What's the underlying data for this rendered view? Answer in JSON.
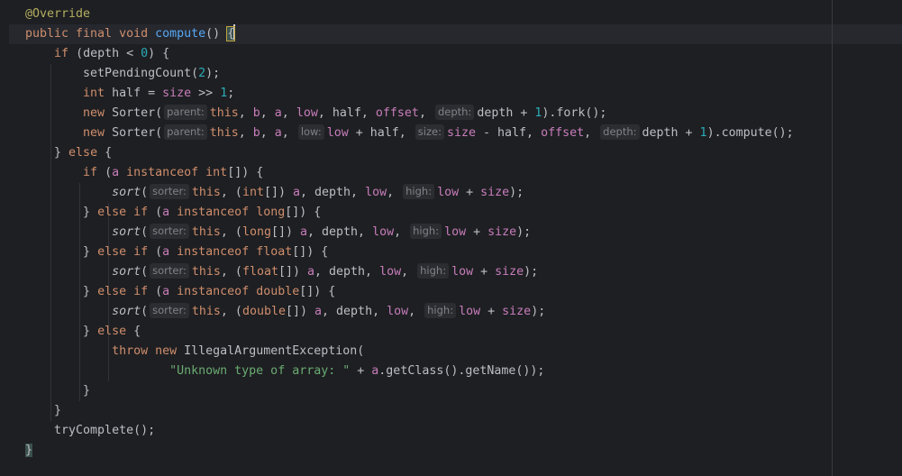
{
  "editor": {
    "language": "java",
    "colors": {
      "background": "#1e1f22",
      "current_line": "#26282e",
      "keyword": "#cf8e6d",
      "annotation": "#b3ae60",
      "method_decl": "#56a8f5",
      "number": "#2aacb8",
      "field": "#c77dbb",
      "string": "#6aab73",
      "default_text": "#bcbec4",
      "inlay_hint": "#7f8288"
    },
    "lines": [
      [
        {
          "t": "@Override",
          "c": "ann"
        }
      ],
      [
        {
          "t": "public final void ",
          "c": "kw"
        },
        {
          "t": "compute",
          "c": "fn"
        },
        {
          "t": "() ",
          "c": "plain"
        },
        {
          "t": "{",
          "c": "brace-hl"
        },
        {
          "t": "",
          "c": "caret"
        }
      ],
      [
        {
          "t": "    "
        },
        {
          "t": "if ",
          "c": "kw"
        },
        {
          "t": "(depth < "
        },
        {
          "t": "0",
          "c": "num"
        },
        {
          "t": ") {"
        }
      ],
      [
        {
          "t": "        setPendingCount("
        },
        {
          "t": "2",
          "c": "num"
        },
        {
          "t": ");"
        }
      ],
      [
        {
          "t": "        "
        },
        {
          "t": "int ",
          "c": "kw"
        },
        {
          "t": "half = "
        },
        {
          "t": "size",
          "c": "fld"
        },
        {
          "t": " >> "
        },
        {
          "t": "1",
          "c": "num"
        },
        {
          "t": ";"
        }
      ],
      [
        {
          "t": "        "
        },
        {
          "t": "new ",
          "c": "kw"
        },
        {
          "t": "Sorter("
        },
        {
          "t": "parent:",
          "c": "hint"
        },
        {
          "t": "this",
          "c": "kw"
        },
        {
          "t": ", "
        },
        {
          "t": "b",
          "c": "fld"
        },
        {
          "t": ", "
        },
        {
          "t": "a",
          "c": "fld"
        },
        {
          "t": ", "
        },
        {
          "t": "low",
          "c": "fld"
        },
        {
          "t": ", half, "
        },
        {
          "t": "offset",
          "c": "fld"
        },
        {
          "t": ", "
        },
        {
          "t": "depth:",
          "c": "hint"
        },
        {
          "t": "depth + "
        },
        {
          "t": "1",
          "c": "num"
        },
        {
          "t": ").fork();"
        }
      ],
      [
        {
          "t": "        "
        },
        {
          "t": "new ",
          "c": "kw"
        },
        {
          "t": "Sorter("
        },
        {
          "t": "parent:",
          "c": "hint"
        },
        {
          "t": "this",
          "c": "kw"
        },
        {
          "t": ", "
        },
        {
          "t": "b",
          "c": "fld"
        },
        {
          "t": ", "
        },
        {
          "t": "a",
          "c": "fld"
        },
        {
          "t": ", "
        },
        {
          "t": "low:",
          "c": "hint"
        },
        {
          "t": "low",
          "c": "fld"
        },
        {
          "t": " + half, "
        },
        {
          "t": "size:",
          "c": "hint"
        },
        {
          "t": "size",
          "c": "fld"
        },
        {
          "t": " - half, "
        },
        {
          "t": "offset",
          "c": "fld"
        },
        {
          "t": ", "
        },
        {
          "t": "depth:",
          "c": "hint"
        },
        {
          "t": "depth + "
        },
        {
          "t": "1",
          "c": "num"
        },
        {
          "t": ").compute();"
        }
      ],
      [
        {
          "t": "    } "
        },
        {
          "t": "else ",
          "c": "kw"
        },
        {
          "t": "{"
        }
      ],
      [
        {
          "t": "        "
        },
        {
          "t": "if ",
          "c": "kw"
        },
        {
          "t": "("
        },
        {
          "t": "a ",
          "c": "fld"
        },
        {
          "t": "instanceof int",
          "c": "kw"
        },
        {
          "t": "[]) {"
        }
      ],
      [
        {
          "t": "            "
        },
        {
          "t": "sort",
          "c": "ital"
        },
        {
          "t": "("
        },
        {
          "t": "sorter:",
          "c": "hint"
        },
        {
          "t": "this",
          "c": "kw"
        },
        {
          "t": ", ("
        },
        {
          "t": "int",
          "c": "kw"
        },
        {
          "t": "[]) "
        },
        {
          "t": "a",
          "c": "fld"
        },
        {
          "t": ", depth, "
        },
        {
          "t": "low",
          "c": "fld"
        },
        {
          "t": ", "
        },
        {
          "t": "high:",
          "c": "hint"
        },
        {
          "t": "low",
          "c": "fld"
        },
        {
          "t": " + "
        },
        {
          "t": "size",
          "c": "fld"
        },
        {
          "t": ");"
        }
      ],
      [
        {
          "t": "        } "
        },
        {
          "t": "else if ",
          "c": "kw"
        },
        {
          "t": "("
        },
        {
          "t": "a ",
          "c": "fld"
        },
        {
          "t": "instanceof long",
          "c": "kw"
        },
        {
          "t": "[]) {"
        }
      ],
      [
        {
          "t": "            "
        },
        {
          "t": "sort",
          "c": "ital"
        },
        {
          "t": "("
        },
        {
          "t": "sorter:",
          "c": "hint"
        },
        {
          "t": "this",
          "c": "kw"
        },
        {
          "t": ", ("
        },
        {
          "t": "long",
          "c": "kw"
        },
        {
          "t": "[]) "
        },
        {
          "t": "a",
          "c": "fld"
        },
        {
          "t": ", depth, "
        },
        {
          "t": "low",
          "c": "fld"
        },
        {
          "t": ", "
        },
        {
          "t": "high:",
          "c": "hint"
        },
        {
          "t": "low",
          "c": "fld"
        },
        {
          "t": " + "
        },
        {
          "t": "size",
          "c": "fld"
        },
        {
          "t": ");"
        }
      ],
      [
        {
          "t": "        } "
        },
        {
          "t": "else if ",
          "c": "kw"
        },
        {
          "t": "("
        },
        {
          "t": "a ",
          "c": "fld"
        },
        {
          "t": "instanceof float",
          "c": "kw"
        },
        {
          "t": "[]) {"
        }
      ],
      [
        {
          "t": "            "
        },
        {
          "t": "sort",
          "c": "ital"
        },
        {
          "t": "("
        },
        {
          "t": "sorter:",
          "c": "hint"
        },
        {
          "t": "this",
          "c": "kw"
        },
        {
          "t": ", ("
        },
        {
          "t": "float",
          "c": "kw"
        },
        {
          "t": "[]) "
        },
        {
          "t": "a",
          "c": "fld"
        },
        {
          "t": ", depth, "
        },
        {
          "t": "low",
          "c": "fld"
        },
        {
          "t": ", "
        },
        {
          "t": "high:",
          "c": "hint"
        },
        {
          "t": "low",
          "c": "fld"
        },
        {
          "t": " + "
        },
        {
          "t": "size",
          "c": "fld"
        },
        {
          "t": ");"
        }
      ],
      [
        {
          "t": "        } "
        },
        {
          "t": "else if ",
          "c": "kw"
        },
        {
          "t": "("
        },
        {
          "t": "a ",
          "c": "fld"
        },
        {
          "t": "instanceof double",
          "c": "kw"
        },
        {
          "t": "[]) {"
        }
      ],
      [
        {
          "t": "            "
        },
        {
          "t": "sort",
          "c": "ital"
        },
        {
          "t": "("
        },
        {
          "t": "sorter:",
          "c": "hint"
        },
        {
          "t": "this",
          "c": "kw"
        },
        {
          "t": ", ("
        },
        {
          "t": "double",
          "c": "kw"
        },
        {
          "t": "[]) "
        },
        {
          "t": "a",
          "c": "fld"
        },
        {
          "t": ", depth, "
        },
        {
          "t": "low",
          "c": "fld"
        },
        {
          "t": ", "
        },
        {
          "t": "high:",
          "c": "hint"
        },
        {
          "t": "low",
          "c": "fld"
        },
        {
          "t": " + "
        },
        {
          "t": "size",
          "c": "fld"
        },
        {
          "t": ");"
        }
      ],
      [
        {
          "t": "        } "
        },
        {
          "t": "else ",
          "c": "kw"
        },
        {
          "t": "{"
        }
      ],
      [
        {
          "t": "            "
        },
        {
          "t": "throw new ",
          "c": "kw"
        },
        {
          "t": "IllegalArgumentException("
        }
      ],
      [
        {
          "t": "                    "
        },
        {
          "t": "\"Unknown type of array: \"",
          "c": "str"
        },
        {
          "t": " + "
        },
        {
          "t": "a",
          "c": "fld"
        },
        {
          "t": ".getClass().getName());"
        }
      ],
      [
        {
          "t": "        }"
        }
      ],
      [
        {
          "t": "    }"
        }
      ],
      [
        {
          "t": "    tryComplete();"
        }
      ],
      [
        {
          "t": "}",
          "c": "brace-end"
        }
      ]
    ]
  }
}
